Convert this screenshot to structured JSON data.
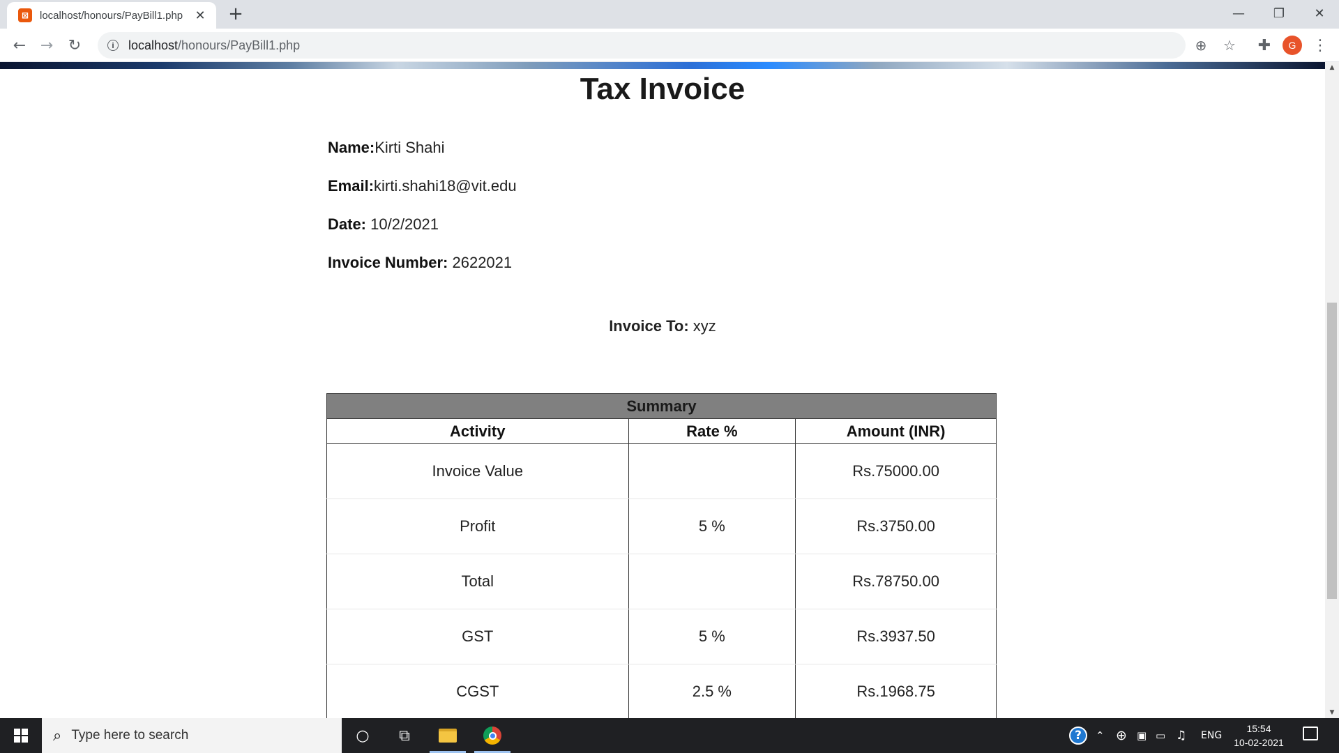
{
  "browser": {
    "tab_title": "localhost/honours/PayBill1.php",
    "favicon_glyph": "⊠",
    "new_tab": "+",
    "url_host": "localhost",
    "url_path": "/honours/PayBill1.php",
    "profile_initial": "G",
    "window_controls": {
      "minimize": "—",
      "restore": "❐",
      "close": "✕"
    }
  },
  "page": {
    "title": "Tax Invoice",
    "fields": [
      {
        "label": "Name:",
        "value": "Kirti Shahi"
      },
      {
        "label": "Email:",
        "value": "kirti.shahi18@vit.edu"
      },
      {
        "label": "Date:",
        "value": " 10/2/2021"
      },
      {
        "label": "Invoice Number:",
        "value": " 2622021"
      }
    ],
    "invoice_to_label": "Invoice To:",
    "invoice_to_value": " xyz",
    "summary": {
      "caption": "Summary",
      "columns": [
        "Activity",
        "Rate %",
        "Amount (INR)"
      ],
      "rows": [
        {
          "activity": "Invoice Value",
          "rate": "",
          "amount": "Rs.75000.00"
        },
        {
          "activity": "Profit",
          "rate": "5 %",
          "amount": "Rs.3750.00"
        },
        {
          "activity": "Total",
          "rate": "",
          "amount": "Rs.78750.00"
        },
        {
          "activity": "GST",
          "rate": "5 %",
          "amount": "Rs.3937.50"
        },
        {
          "activity": "CGST",
          "rate": "2.5 %",
          "amount": "Rs.1968.75"
        }
      ]
    }
  },
  "taskbar": {
    "search_placeholder": "Type here to search",
    "language": "ENG",
    "time": "15:54",
    "date": "10-02-2021"
  }
}
